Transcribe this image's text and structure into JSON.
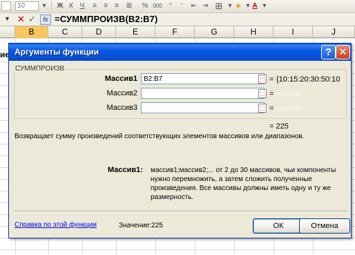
{
  "toolbar": {
    "font_size": "10",
    "icons": [
      "dropdown-arrow",
      "bold",
      "italic",
      "underline",
      "align-left",
      "align-center",
      "align-right",
      "merge-center",
      "percent",
      "thousands",
      "increase-decimal",
      "decrease-decimal",
      "decrease-indent",
      "increase-indent",
      "borders",
      "fill-color",
      "font-color"
    ],
    "percent_glyph": "%",
    "thousands_glyph": "000"
  },
  "formula_bar": {
    "formula": "=СУММПРОИЗВ(B2:B7)",
    "cancel_glyph": "✕",
    "enter_glyph": "✓",
    "fx_glyph": "fx"
  },
  "sheet": {
    "columns": [
      "B",
      "C",
      "D",
      "E",
      "F",
      "G",
      "H",
      "I",
      "J"
    ],
    "active_column": "B",
    "partial_cell_text": "ие"
  },
  "dialog": {
    "title": "Аргументы функции",
    "help_glyph": "?",
    "close_glyph": "✕",
    "function_name": "СУММПРОИЗВ",
    "args": [
      {
        "label": "Массив1",
        "value": "B2:B7",
        "result": "{10:15:20:30:50:10"
      },
      {
        "label": "Массив2",
        "value": "",
        "result": "массив"
      },
      {
        "label": "Массив3",
        "value": "",
        "result": "массив"
      }
    ],
    "equals": "=",
    "result_total": "= 225",
    "description": "Возвращает сумму произведений соответствующих элементов массивов или диапазонов.",
    "help_label": "Массив1:",
    "help_text": "массив1;массив2;... от 2 до 30 массивов, чьи компоненты нужно перемножить, а затем сложить полученные произведения. Все массивы должны иметь одну и ту же размерность.",
    "help_link": "Справка по этой функции",
    "value_label": "Значение:225",
    "ok_label": "ОК",
    "cancel_label": "Отмена"
  }
}
